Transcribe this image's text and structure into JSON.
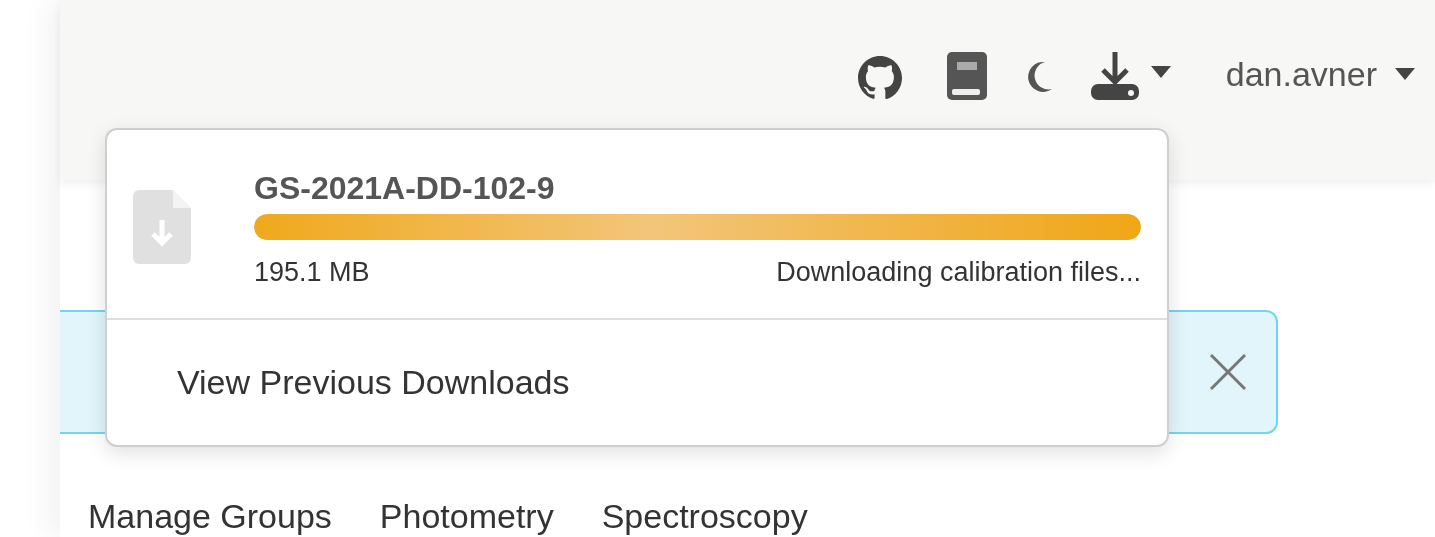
{
  "navbar": {
    "user": "dan.avner"
  },
  "downloads_menu": {
    "items": [
      {
        "name": "GS-2021A-DD-102-9",
        "level": 1,
        "size": "195.1 MB",
        "status": "Downloading calibration files..."
      }
    ],
    "footer_link": "View Previous Downloads"
  },
  "tabs": [
    "Manage Groups",
    "Photometry",
    "Spectroscopy"
  ]
}
